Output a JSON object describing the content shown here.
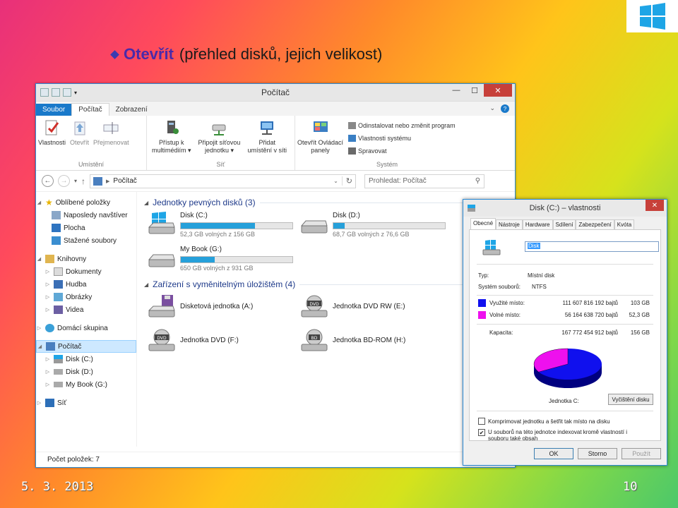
{
  "slide": {
    "title_strong": "Otevřít",
    "title_rest": "(přehled disků, jejich velikost)",
    "date": "5. 3. 2013",
    "page": "10"
  },
  "explorer": {
    "title": "Počítač",
    "tabs": [
      "Soubor",
      "Počítač",
      "Zobrazení"
    ],
    "ribbon": {
      "umisteni": {
        "name": "Umístění",
        "buttons": [
          "Vlastnosti",
          "Otevřít",
          "Přejmenovat"
        ]
      },
      "sit": {
        "name": "Síť",
        "btn1_l1": "Přístup k",
        "btn1_l2": "multimédiím ▾",
        "btn2_l1": "Připojit síťovou",
        "btn2_l2": "jednotku ▾",
        "btn3_l1": "Přidat",
        "btn3_l2": "umístění v síti"
      },
      "system": {
        "name": "Systém",
        "big_l1": "Otevřít Ovládací",
        "big_l2": "panely",
        "items": [
          "Odinstalovat nebo změnit program",
          "Vlastnosti systému",
          "Spravovat"
        ]
      }
    },
    "address": "Počítač",
    "search_placeholder": "Prohledat: Počítač",
    "nav": {
      "favorites": "Oblíbené položky",
      "fav_items": [
        "Naposledy navštíver",
        "Plocha",
        "Stažené soubory"
      ],
      "libraries": "Knihovny",
      "lib_items": [
        "Dokumenty",
        "Hudba",
        "Obrázky",
        "Videa"
      ],
      "homegroup": "Domácí skupina",
      "computer": "Počítač",
      "comp_items": [
        "Disk (C:)",
        "Disk (D:)",
        "My Book (G:)"
      ],
      "network": "Síť"
    },
    "hdd_header": "Jednotky pevných disků (3)",
    "hdd": [
      {
        "name": "Disk (C:)",
        "free": "52,3 GB volných z 156 GB",
        "used": 0.665
      },
      {
        "name": "Disk (D:)",
        "free": "68,7 GB volných z 76,6 GB",
        "used": 0.103
      },
      {
        "name": "My Book (G:)",
        "free": "650 GB volných z 931 GB",
        "used": 0.302
      }
    ],
    "removable_header": "Zařízení s vyměnitelným úložištěm (4)",
    "removable": [
      "Disketová jednotka (A:)",
      "Jednotka DVD RW (E:)",
      "Jednotka DVD (F:)",
      "Jednotka BD-ROM (H:)"
    ],
    "status": "Počet položek: 7"
  },
  "dialog": {
    "title": "Disk (C:) – vlastnosti",
    "tabs": [
      "Obecné",
      "Nástroje",
      "Hardware",
      "Sdílení",
      "Zabezpečení",
      "Kvóta"
    ],
    "name_value": "Disk",
    "type_label": "Typ:",
    "type_value": "Místní disk",
    "fs_label": "Systém souborů:",
    "fs_value": "NTFS",
    "used_label": "Využité místo:",
    "used_bytes": "111 607 816 192 bajtů",
    "used_gb": "103 GB",
    "free_label": "Volné místo:",
    "free_bytes": "56 164 638 720 bajtů",
    "free_gb": "52,3 GB",
    "cap_label": "Kapacita:",
    "cap_bytes": "167 772 454 912 bajtů",
    "cap_gb": "156 GB",
    "used_fraction": 0.665,
    "colors": {
      "used": "#1010ee",
      "free": "#ee10ee"
    },
    "drive_label": "Jednotka C:",
    "cleanup_button": "Vyčištění disku",
    "compress_label": "Komprimovat jednotku a šetřit tak místo na disku",
    "index_label_1": "U souborů na této jednotce indexovat kromě vlastností i",
    "index_label_2": "souboru také obsah",
    "buttons": {
      "ok": "OK",
      "cancel": "Storno",
      "apply": "Použít"
    }
  }
}
